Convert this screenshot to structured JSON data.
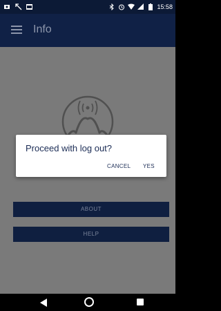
{
  "status_bar": {
    "time": "15:58",
    "left_icons": [
      "notification-icon",
      "missed-call-icon",
      "gallery-icon"
    ],
    "right_icons": [
      "bluetooth-icon",
      "alarm-icon",
      "wifi-icon",
      "signal-icon",
      "battery-icon"
    ]
  },
  "app_bar": {
    "title": "Info",
    "menu_icon": "hamburger-menu-icon"
  },
  "main": {
    "logo_icon": "broadcast-tower-logo",
    "buttons": {
      "about": "ABOUT",
      "help": "HELP"
    }
  },
  "dialog": {
    "title": "Proceed with log out?",
    "cancel_label": "CANCEL",
    "confirm_label": "YES"
  },
  "nav_bar": {
    "icons": [
      "back-icon",
      "home-icon",
      "recents-icon"
    ]
  },
  "colors": {
    "app_bar": "#102146",
    "status_bar": "#0c1a36",
    "scrim": "#7a7a7a",
    "button": "#0f1f40",
    "dialog_text": "#1b2c55"
  }
}
